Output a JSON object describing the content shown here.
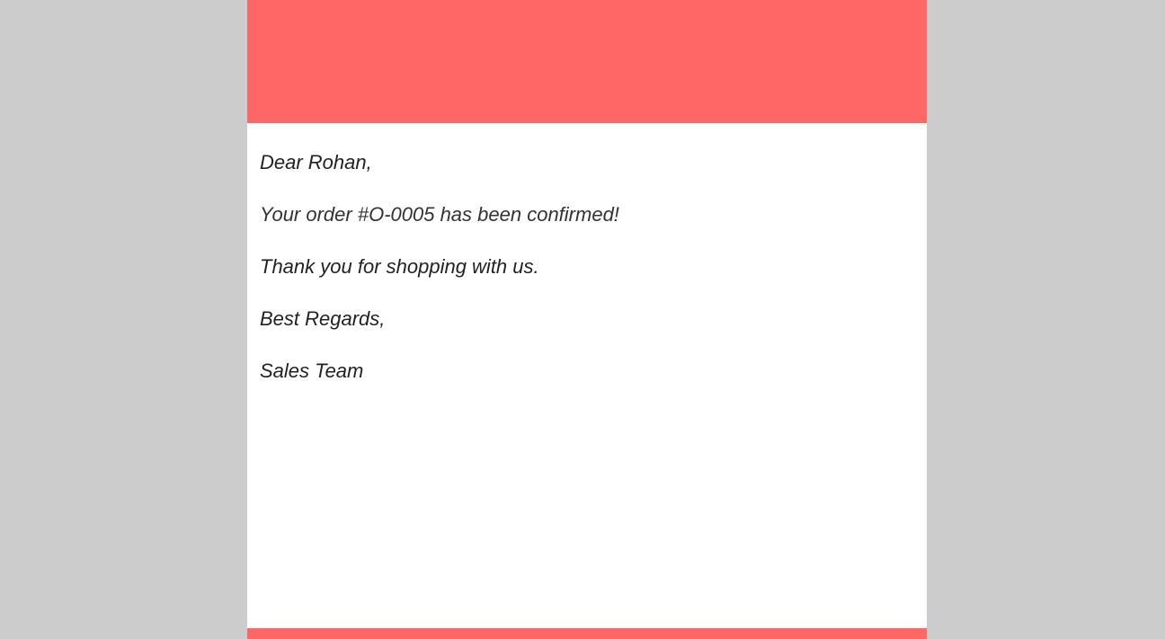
{
  "colors": {
    "page_background": "#cccccc",
    "header_band": "#ff6666",
    "footer_band": "#ff6666",
    "card_background": "#ffffff",
    "text": "#222222"
  },
  "email": {
    "greeting": "Dear Rohan,",
    "order_confirmation": "Your order #O-0005 has been confirmed!",
    "thanks": "Thank you for shopping with us.",
    "closing": "Best Regards,",
    "signature": "Sales Team"
  }
}
